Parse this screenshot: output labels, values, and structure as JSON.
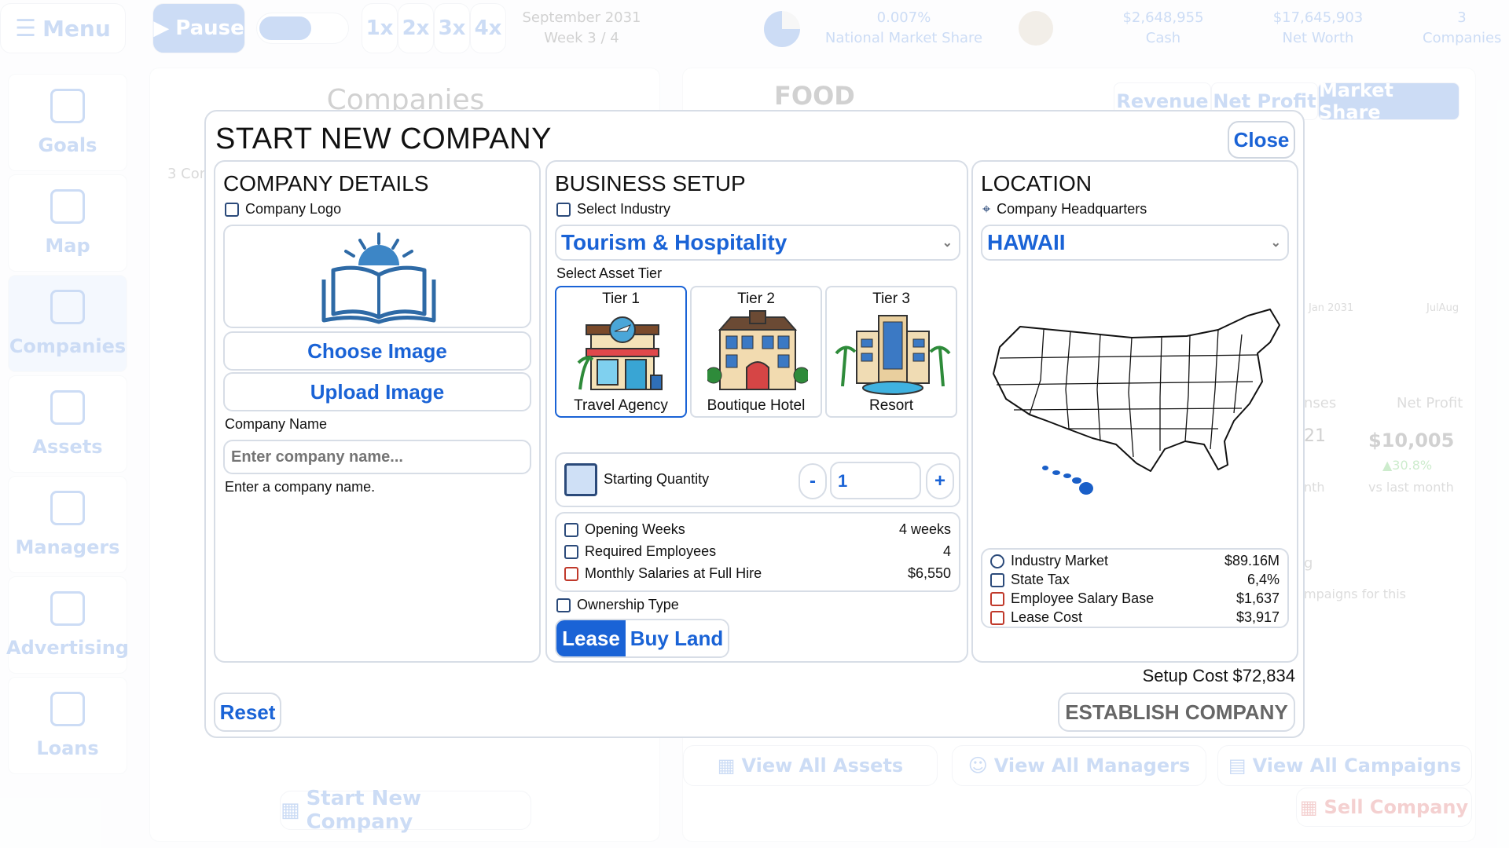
{
  "topbar": {
    "menu_label": "Menu",
    "pause_label": "Pause",
    "speeds": [
      "1x",
      "2x",
      "3x",
      "4x"
    ],
    "date_line1": "September 2031",
    "date_line2": "Week 3 / 4",
    "market_share_value": "0.007%",
    "market_share_label": "National Market Share",
    "cash_value": "$2,648,955",
    "cash_label": "Cash",
    "networth_value": "$17,645,903",
    "networth_label": "Net Worth",
    "companies_value": "3",
    "companies_label": "Companies"
  },
  "sidebar": {
    "items": [
      {
        "label": "Goals"
      },
      {
        "label": "Map"
      },
      {
        "label": "Companies"
      },
      {
        "label": "Assets"
      },
      {
        "label": "Managers"
      },
      {
        "label": "Advertising"
      },
      {
        "label": "Loans"
      }
    ]
  },
  "background": {
    "companies_title": "Companies",
    "companies_count": "3 Cor",
    "food_title": "FOOD",
    "tabs": [
      "Revenue",
      "Net Profit",
      "Market Share"
    ],
    "chart_x1": "Jan 2031",
    "chart_x2": "JulAug",
    "expenses_label": "nses",
    "net_profit_label": "Net Profit",
    "net_profit_value": "$10,005",
    "net_profit_change": "▲30.8%",
    "vs_last_month": "vs last month",
    "left_val": "21",
    "left_sub": "nth",
    "campaign_text": "mpaigns for this",
    "campaign_g": "g",
    "view_assets": "View All Assets",
    "view_managers": "View All Managers",
    "view_campaigns": "View All Campaigns",
    "sell_company": "Sell Company",
    "start_new_company": "Start New Company"
  },
  "modal": {
    "title": "START NEW COMPANY",
    "close_label": "Close",
    "company_details": {
      "heading": "COMPANY DETAILS",
      "logo_label": "Company Logo",
      "choose_image": "Choose Image",
      "upload_image": "Upload Image",
      "name_label": "Company Name",
      "name_placeholder": "Enter company name...",
      "name_hint": "Enter a company name."
    },
    "business_setup": {
      "heading": "BUSINESS SETUP",
      "industry_label": "Select Industry",
      "industry_value": "Tourism & Hospitality",
      "tier_label": "Select Asset Tier",
      "tiers": [
        {
          "name": "Tier 1",
          "label": "Travel Agency"
        },
        {
          "name": "Tier 2",
          "label": "Boutique Hotel"
        },
        {
          "name": "Tier 3",
          "label": "Resort"
        }
      ],
      "starting_quantity_label": "Starting Quantity",
      "minus": "-",
      "plus": "+",
      "quantity": "1",
      "opening_weeks_label": "Opening Weeks",
      "opening_weeks_value": "4 weeks",
      "required_employees_label": "Required Employees",
      "required_employees_value": "4",
      "monthly_salaries_label": "Monthly Salaries at Full Hire",
      "monthly_salaries_value": "$6,550",
      "ownership_label": "Ownership Type",
      "lease_label": "Lease",
      "buy_land_label": "Buy Land"
    },
    "location": {
      "heading": "LOCATION",
      "hq_label": "Company Headquarters",
      "hq_value": "HAWAII",
      "industry_market_label": "Industry Market",
      "industry_market_value": "$89.16M",
      "state_tax_label": "State Tax",
      "state_tax_value": "6,4%",
      "salary_base_label": "Employee Salary Base",
      "salary_base_value": "$1,637",
      "lease_cost_label": "Lease Cost",
      "lease_cost_value": "$3,917"
    },
    "setup_cost_label": "Setup Cost",
    "setup_cost_value": "$72,834",
    "reset_label": "Reset",
    "establish_label": "ESTABLISH COMPANY"
  },
  "colors": {
    "accent": "#1a63d6",
    "border": "#d7dde6",
    "selected_state": "#1a5fc8"
  }
}
